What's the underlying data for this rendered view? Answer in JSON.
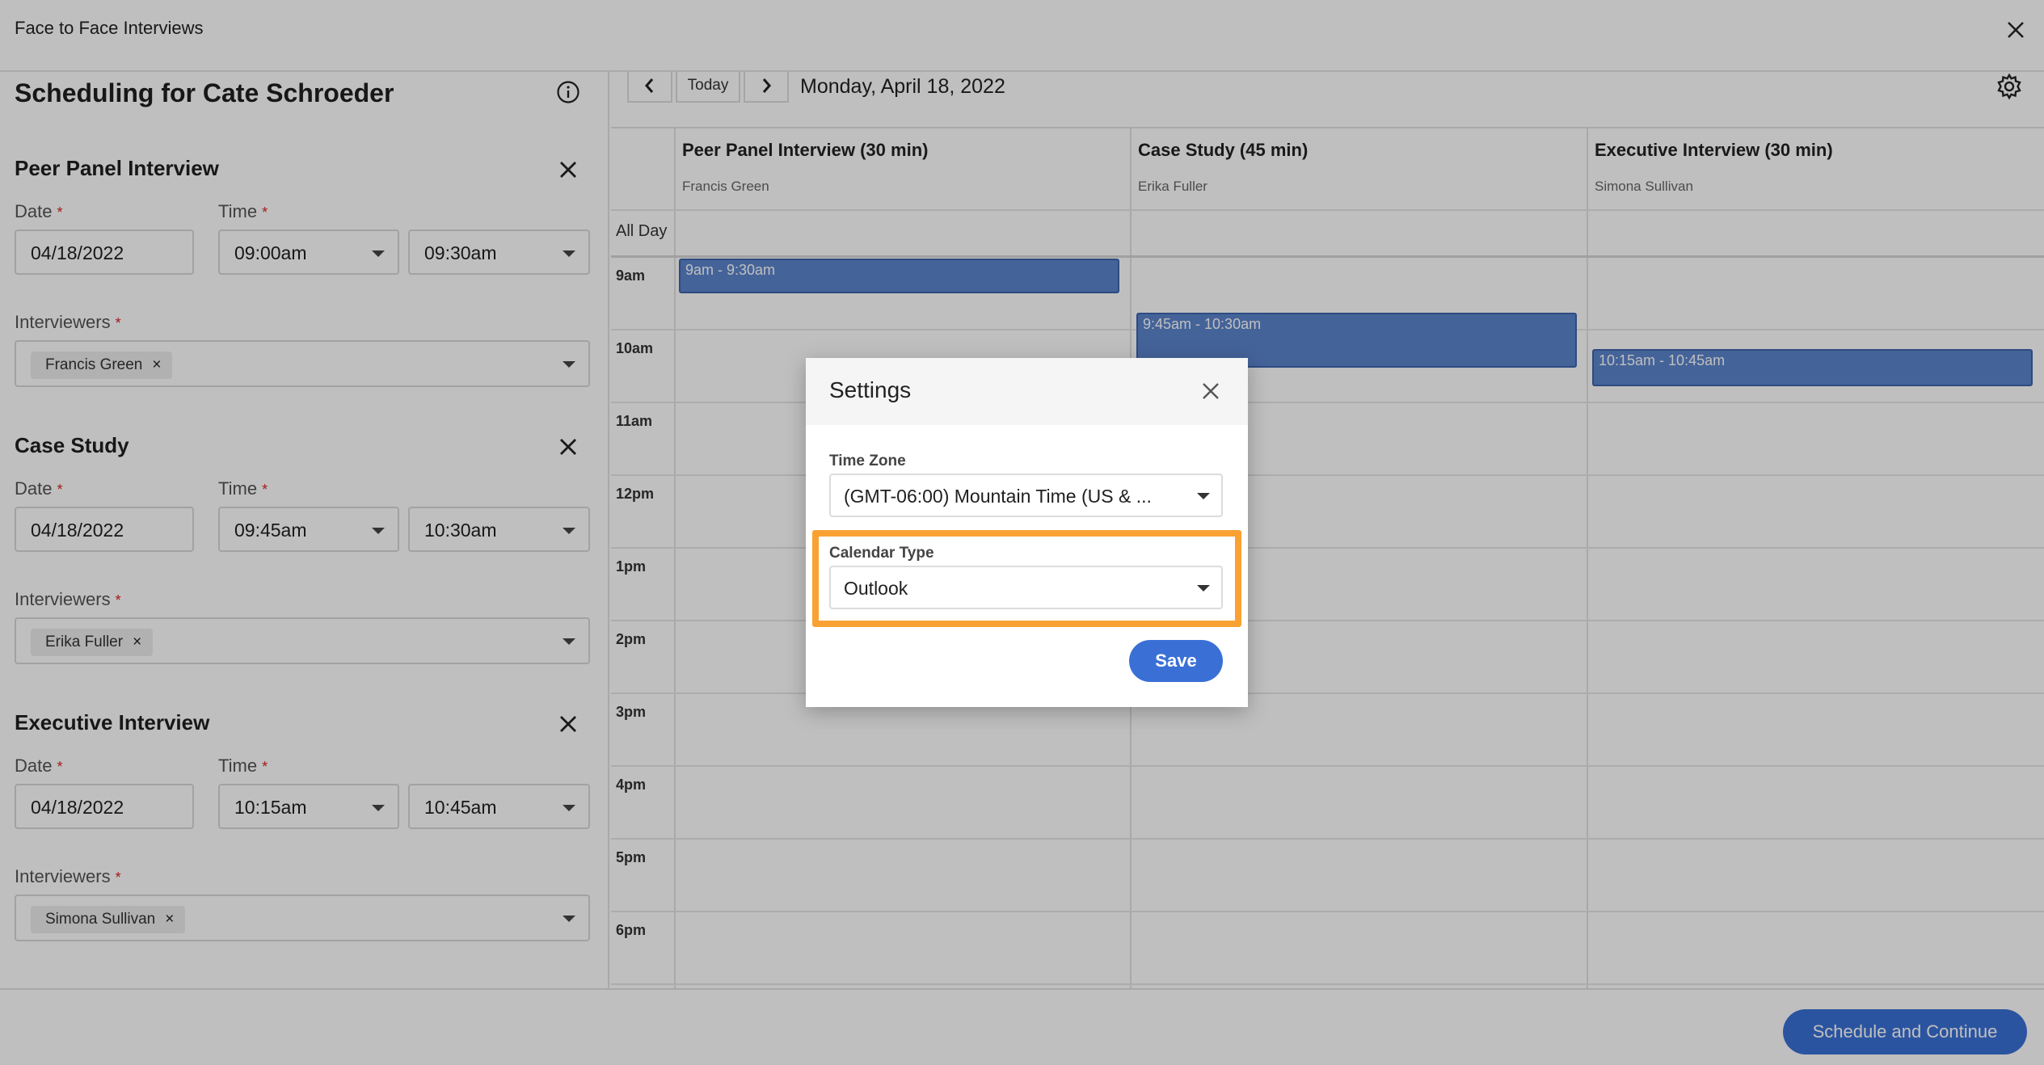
{
  "window": {
    "title": "Face to Face Interviews"
  },
  "left_panel": {
    "heading": "Scheduling for Cate Schroeder",
    "date_label": "Date",
    "time_label": "Time",
    "interviewers_label": "Interviewers",
    "required_mark": "*",
    "sections": [
      {
        "title": "Peer Panel Interview",
        "date": "04/18/2022",
        "start": "09:00am",
        "end": "09:30am",
        "interviewer": "Francis Green"
      },
      {
        "title": "Case Study",
        "date": "04/18/2022",
        "start": "09:45am",
        "end": "10:30am",
        "interviewer": "Erika Fuller"
      },
      {
        "title": "Executive Interview",
        "date": "04/18/2022",
        "start": "10:15am",
        "end": "10:45am",
        "interviewer": "Simona Sullivan"
      }
    ]
  },
  "calendar": {
    "today_label": "Today",
    "date": "Monday, April 18, 2022",
    "all_day_label": "All Day",
    "columns": [
      {
        "title": "Peer Panel Interview (30 min)",
        "person": "Francis Green",
        "event": "9am - 9:30am"
      },
      {
        "title": "Case Study (45 min)",
        "person": "Erika Fuller",
        "event": "9:45am - 10:30am"
      },
      {
        "title": "Executive Interview (30 min)",
        "person": "Simona Sullivan",
        "event": "10:15am - 10:45am"
      }
    ],
    "hours": [
      "9am",
      "10am",
      "11am",
      "12pm",
      "1pm",
      "2pm",
      "3pm",
      "4pm",
      "5pm",
      "6pm"
    ]
  },
  "footer": {
    "primary_label": "Schedule and Continue"
  },
  "settings_modal": {
    "title": "Settings",
    "timezone_label": "Time Zone",
    "timezone_value": "(GMT-06:00) Mountain Time (US & ...",
    "calendar_type_label": "Calendar Type",
    "calendar_type_value": "Outlook",
    "save_label": "Save"
  },
  "colors": {
    "accent": "#3a70d6",
    "event": "#5b84cd",
    "highlight": "#f9a233"
  }
}
